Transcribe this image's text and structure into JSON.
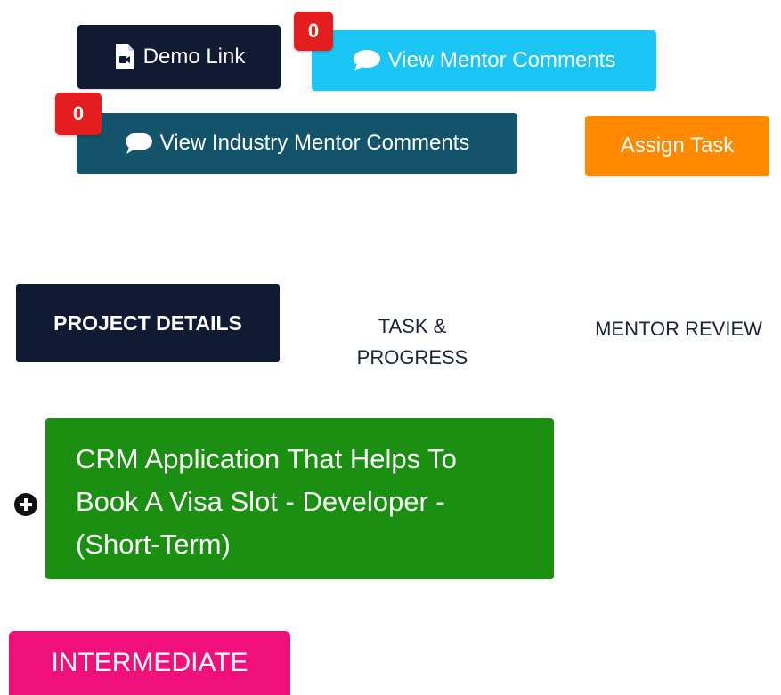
{
  "colors": {
    "dark_navy": "#111a33",
    "cyan": "#1cc6f4",
    "teal": "#13546b",
    "orange": "#ff8a00",
    "green": "#1a8f12",
    "pink": "#f0107b",
    "badge_red": "#e41e1e",
    "text_dark": "#1b2438"
  },
  "toolbar": {
    "demo_link_label": "Demo Link",
    "view_mentor_comments_label": "View Mentor Comments",
    "view_mentor_comments_count": "0",
    "view_industry_mentor_comments_label": "View Industry Mentor Comments",
    "view_industry_mentor_comments_count": "0",
    "assign_task_label": "Assign Task"
  },
  "tabs": [
    {
      "label": "PROJECT DETAILS",
      "active": true
    },
    {
      "label": "TASK & PROGRESS",
      "active": false
    },
    {
      "label": "MENTOR REVIEW",
      "active": false
    }
  ],
  "project": {
    "title": "CRM Application That Helps To Book A Visa Slot - Developer - (Short-Term)",
    "level": "INTERMEDIATE"
  },
  "icons": {
    "demo_link": "video-file-icon",
    "comments": "speech-bubble-icon",
    "expand": "plus-circle-icon"
  }
}
